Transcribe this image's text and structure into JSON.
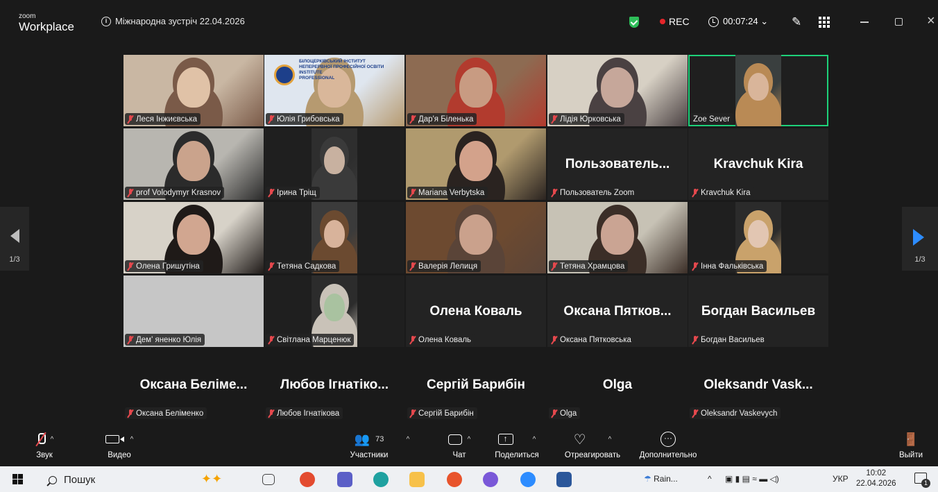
{
  "app": {
    "logo_top": "zoom",
    "logo_bottom": "Workplace",
    "meeting_title": "Міжнародна зустріч 22.04.2026"
  },
  "status": {
    "rec": "REC",
    "timer": "00:07:24 ⌄"
  },
  "pagination": {
    "left": "1/3",
    "right": "1/3"
  },
  "tiles": [
    {
      "name": "Леся Інжиєвська",
      "muted": true,
      "video": true
    },
    {
      "name": "Юлія Грибовська",
      "muted": true,
      "video": true,
      "banner": [
        "БІЛОЦЕРКІВСЬКИЙ ІНСТИТУТ",
        "НЕПЕРЕРВНОЇ ПРОФЕСІЙНОЇ ОСВІТИ",
        "INSTITUTE",
        "PROFESSIONAL"
      ]
    },
    {
      "name": "Дар'я Біленька",
      "muted": true,
      "video": true
    },
    {
      "name": "Лідія Юрковська",
      "muted": true,
      "video": true
    },
    {
      "name": "Zoe Sever",
      "muted": false,
      "video": true,
      "active": true
    },
    {
      "name": "prof Volodymyr Krasnov",
      "muted": true,
      "video": true
    },
    {
      "name": "Ірина Тріщ",
      "muted": true,
      "video": true
    },
    {
      "name": "Mariana Verbytska",
      "muted": true,
      "video": true
    },
    {
      "name": "Пользователь Zoom",
      "display": "Пользователь...",
      "muted": true,
      "video": false
    },
    {
      "name": "Kravchuk Kira",
      "display": "Kravchuk Kira",
      "muted": true,
      "video": false
    },
    {
      "name": "Олена Гришутіна",
      "muted": true,
      "video": true
    },
    {
      "name": "Тетяна Садкова",
      "muted": true,
      "video": true
    },
    {
      "name": "Валерія Лелиця",
      "muted": true,
      "video": true
    },
    {
      "name": "Тетяна Храмцова",
      "muted": true,
      "video": true
    },
    {
      "name": "Інна Фальківська",
      "muted": true,
      "video": true
    },
    {
      "name": "Дем' яненко Юлія",
      "muted": true,
      "video": true
    },
    {
      "name": "Світлана Марценюк",
      "muted": true,
      "video": true
    },
    {
      "name": "Олена Коваль",
      "display": "Олена Коваль",
      "muted": true,
      "video": false
    },
    {
      "name": "Оксана Пятковська",
      "display": "Оксана Пятков...",
      "muted": true,
      "video": false
    },
    {
      "name": "Богдан Васильев",
      "display": "Богдан Васильев",
      "muted": true,
      "video": false
    },
    {
      "name": "Оксана Беліменко",
      "display": "Оксана Беліме...",
      "muted": true,
      "video": false
    },
    {
      "name": "Любов Ігнатікова",
      "display": "Любов Ігнатіко...",
      "muted": true,
      "video": false
    },
    {
      "name": "Сергій Барибін",
      "display": "Сергій Барибін",
      "muted": true,
      "video": false
    },
    {
      "name": "Olga",
      "display": "Olga",
      "muted": true,
      "video": false
    },
    {
      "name": "Oleksandr Vaskevych",
      "display": "Oleksandr Vask...",
      "muted": true,
      "video": false
    }
  ],
  "toolbar": {
    "audio": "Звук",
    "video": "Видео",
    "participants": "Участники",
    "participants_count": "73",
    "chat": "Чат",
    "share": "Поделиться",
    "react": "Отреагировать",
    "more": "Дополнительно",
    "leave": "Выйти"
  },
  "taskbar": {
    "search": "Пошук",
    "weather": "Rain...",
    "lang": "УКР",
    "time": "10:02",
    "date": "22.04.2026",
    "notifications": "1"
  }
}
